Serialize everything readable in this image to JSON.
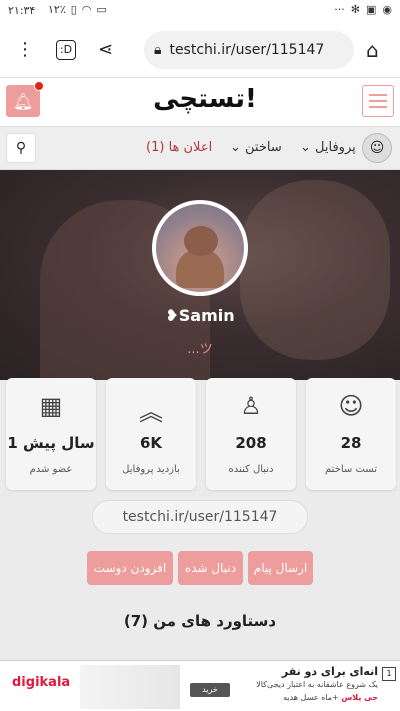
{
  "status_bar": {
    "time": "۲۱:۳۴",
    "battery": "۱۲٪",
    "more": "···"
  },
  "browser": {
    "url": "testchi.ir/user/115147"
  },
  "site_header": {
    "logo": "تستچی!"
  },
  "nav": {
    "notifications": "اعلان ها (1)",
    "build": "ساختن",
    "profile": "پروفایل"
  },
  "profile": {
    "username": "Samin",
    "tagline": "...ツ"
  },
  "stats": [
    {
      "value": "28",
      "label": "تست ساختم"
    },
    {
      "value": "208",
      "label": "دنبال کننده"
    },
    {
      "value": "6K",
      "label": "بازدید پروفایل"
    },
    {
      "value": "1 سال پیش",
      "label": "عضو شدم"
    }
  ],
  "profile_url": "testchi.ir/user/115147",
  "buttons": {
    "message": "ارسال پیام",
    "unfollow": "دنبال شده",
    "add_friend": "افزودن دوست"
  },
  "achievements": "دستاورد های من (7)",
  "ad": {
    "logo": "digikala",
    "title": "انه‌ای برای دو نفر",
    "subtitle": "یک شروع عاشقانه به اعتبار دیجی‌کالا",
    "brand_prefix": "+ماه عسل هدیه",
    "brand": "جی پلاس",
    "button": "خرید",
    "badge": "1"
  }
}
